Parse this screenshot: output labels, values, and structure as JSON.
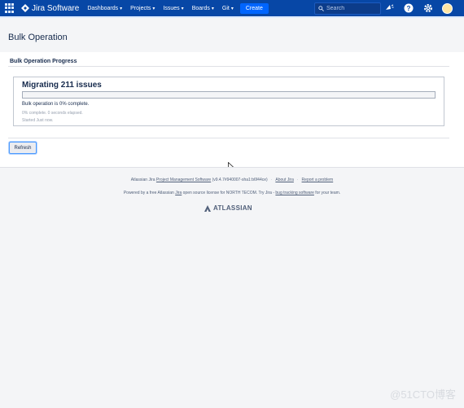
{
  "topnav": {
    "product": "Jira Software",
    "items": [
      {
        "label": "Dashboards"
      },
      {
        "label": "Projects"
      },
      {
        "label": "Issues"
      },
      {
        "label": "Boards"
      },
      {
        "label": "Git"
      }
    ],
    "create_label": "Create",
    "search_placeholder": "Search",
    "colors": {
      "nav_bg": "#0747a6",
      "create_bg": "#0065ff"
    }
  },
  "page": {
    "title": "Bulk Operation",
    "section_title": "Bulk Operation Progress"
  },
  "progress": {
    "heading": "Migrating 211 issues",
    "percent": 0,
    "status": "Bulk operation is 0% complete.",
    "elapsed": "0% complete. 0 seconds elapsed.",
    "started": "Started Just now."
  },
  "actions": {
    "refresh_label": "Refresh"
  },
  "footer": {
    "line1_prefix": "Atlassian Jira ",
    "line1_link": "Project Management Software",
    "line1_version": " (v9.4.7#940007-sha1:b6f44ce)",
    "about": "About Jira",
    "report": "Report a problem",
    "line2_prefix": "Powered by a free Atlassian ",
    "line2_jira": "Jira",
    "line2_mid": " open source license for NORTH TECOM. Try Jira - ",
    "line2_link": "bug tracking software",
    "line2_suffix": " for your team.",
    "brand": "ATLASSIAN"
  },
  "watermark": "@51CTO博客"
}
